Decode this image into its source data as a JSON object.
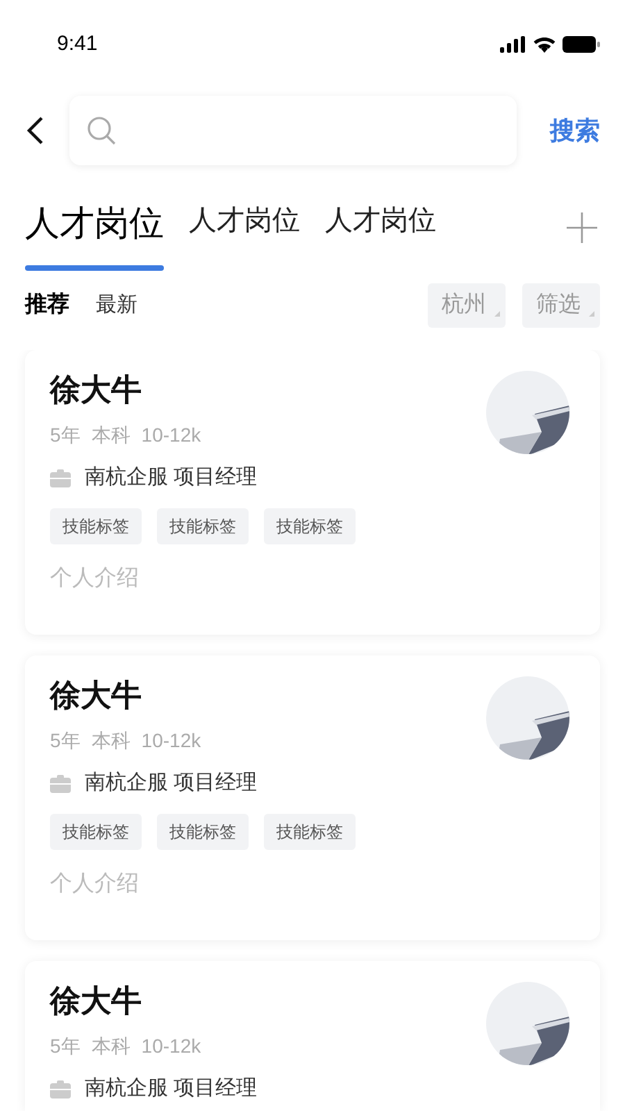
{
  "status_bar": {
    "time": "9:41"
  },
  "search": {
    "button": "搜索"
  },
  "tabs": [
    {
      "label": "人才岗位",
      "selected": true
    },
    {
      "label": "人才岗位",
      "selected": false
    },
    {
      "label": "人才岗位",
      "selected": false
    }
  ],
  "sort_options": [
    {
      "label": "推荐",
      "selected": true
    },
    {
      "label": "最新",
      "selected": false
    }
  ],
  "filters": [
    {
      "label": "杭州"
    },
    {
      "label": "筛选"
    }
  ],
  "candidates": [
    {
      "name": "徐大牛",
      "meta": [
        "5年",
        "本科",
        "10-12k"
      ],
      "company": "南杭企服 项目经理",
      "tags": [
        "技能标签",
        "技能标签",
        "技能标签"
      ],
      "intro": "个人介绍"
    },
    {
      "name": "徐大牛",
      "meta": [
        "5年",
        "本科",
        "10-12k"
      ],
      "company": "南杭企服 项目经理",
      "tags": [
        "技能标签",
        "技能标签",
        "技能标签"
      ],
      "intro": "个人介绍"
    },
    {
      "name": "徐大牛",
      "meta": [
        "5年",
        "本科",
        "10-12k"
      ],
      "company": "南杭企服 项目经理"
    }
  ]
}
